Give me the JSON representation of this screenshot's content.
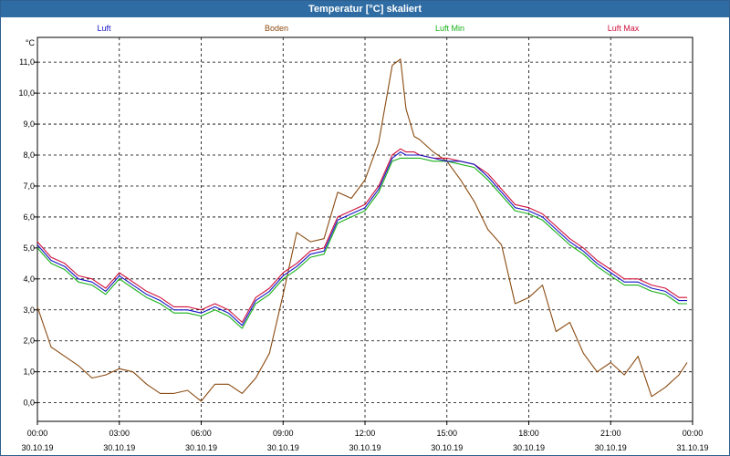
{
  "window": {
    "title": "Temperatur [°C] skaliert"
  },
  "chart_data": {
    "type": "line",
    "title": "Temperatur [°C] skaliert",
    "ylabel": "°C",
    "ylim": [
      -0.6,
      11.8
    ],
    "xlim": [
      0,
      24
    ],
    "grid": true,
    "legend_placement": "top",
    "y_ticks": [
      "0,0",
      "1,0",
      "2,0",
      "3,0",
      "4,0",
      "5,0",
      "6,0",
      "7,0",
      "8,0",
      "9,0",
      "10,0",
      "11,0"
    ],
    "x_ticks": [
      {
        "time": "00:00",
        "date": "30.10.19"
      },
      {
        "time": "03:00",
        "date": "30.10.19"
      },
      {
        "time": "06:00",
        "date": "30.10.19"
      },
      {
        "time": "09:00",
        "date": "30.10.19"
      },
      {
        "time": "12:00",
        "date": "30.10.19"
      },
      {
        "time": "15:00",
        "date": "30.10.19"
      },
      {
        "time": "18:00",
        "date": "30.10.19"
      },
      {
        "time": "21:00",
        "date": "30.10.19"
      },
      {
        "time": "00:00",
        "date": "31.10.19"
      }
    ],
    "x": [
      0.0,
      0.5,
      1.0,
      1.5,
      2.0,
      2.5,
      3.0,
      3.5,
      4.0,
      4.5,
      5.0,
      5.5,
      6.0,
      6.5,
      7.0,
      7.5,
      8.0,
      8.5,
      9.0,
      9.5,
      10.0,
      10.5,
      11.0,
      11.5,
      12.0,
      12.5,
      13.0,
      13.3,
      13.5,
      13.8,
      14.0,
      14.5,
      15.0,
      15.5,
      16.0,
      16.5,
      17.0,
      17.5,
      18.0,
      18.5,
      19.0,
      19.5,
      20.0,
      20.5,
      21.0,
      21.5,
      22.0,
      22.5,
      23.0,
      23.5,
      23.8
    ],
    "series": [
      {
        "name": "Luft",
        "color": "#1515c8",
        "values": [
          5.1,
          4.6,
          4.4,
          4.0,
          3.9,
          3.6,
          4.1,
          3.8,
          3.5,
          3.3,
          3.0,
          3.0,
          2.9,
          3.1,
          2.9,
          2.5,
          3.3,
          3.6,
          4.1,
          4.4,
          4.8,
          4.9,
          5.9,
          6.1,
          6.3,
          6.9,
          7.9,
          8.1,
          8.0,
          8.0,
          8.0,
          7.9,
          7.8,
          7.8,
          7.7,
          7.3,
          6.8,
          6.3,
          6.2,
          6.0,
          5.6,
          5.2,
          4.9,
          4.5,
          4.2,
          3.9,
          3.9,
          3.7,
          3.6,
          3.3,
          3.3
        ]
      },
      {
        "name": "Boden",
        "color": "#8a4a10",
        "values": [
          3.1,
          1.8,
          1.5,
          1.2,
          0.8,
          0.9,
          1.1,
          1.0,
          0.6,
          0.3,
          0.3,
          0.4,
          0.05,
          0.6,
          0.6,
          0.3,
          0.8,
          1.6,
          3.5,
          5.5,
          5.2,
          5.3,
          6.8,
          6.6,
          7.2,
          8.4,
          10.9,
          11.1,
          9.5,
          8.6,
          8.5,
          8.1,
          7.8,
          7.2,
          6.5,
          5.6,
          5.1,
          3.2,
          3.4,
          3.8,
          2.3,
          2.6,
          1.6,
          1.0,
          1.3,
          0.9,
          1.5,
          0.2,
          0.5,
          0.9,
          1.3
        ]
      },
      {
        "name": "Luft Min",
        "color": "#18b018",
        "values": [
          5.0,
          4.5,
          4.3,
          3.9,
          3.8,
          3.5,
          4.0,
          3.7,
          3.4,
          3.2,
          2.9,
          2.9,
          2.8,
          3.0,
          2.8,
          2.4,
          3.2,
          3.5,
          4.0,
          4.3,
          4.7,
          4.8,
          5.8,
          6.0,
          6.2,
          6.8,
          7.8,
          7.9,
          7.9,
          7.9,
          7.9,
          7.8,
          7.8,
          7.7,
          7.6,
          7.2,
          6.7,
          6.2,
          6.1,
          5.9,
          5.5,
          5.1,
          4.8,
          4.4,
          4.1,
          3.8,
          3.8,
          3.6,
          3.5,
          3.2,
          3.2
        ]
      },
      {
        "name": "Luft Max",
        "color": "#d0103a",
        "values": [
          5.2,
          4.7,
          4.5,
          4.1,
          4.0,
          3.7,
          4.2,
          3.9,
          3.6,
          3.4,
          3.1,
          3.1,
          3.0,
          3.2,
          3.0,
          2.6,
          3.4,
          3.7,
          4.2,
          4.5,
          4.9,
          5.0,
          6.0,
          6.2,
          6.4,
          7.0,
          8.0,
          8.2,
          8.1,
          8.1,
          8.0,
          7.9,
          7.9,
          7.8,
          7.7,
          7.4,
          6.9,
          6.4,
          6.3,
          6.1,
          5.7,
          5.3,
          5.0,
          4.6,
          4.3,
          4.0,
          4.0,
          3.8,
          3.7,
          3.4,
          3.4
        ]
      }
    ]
  }
}
